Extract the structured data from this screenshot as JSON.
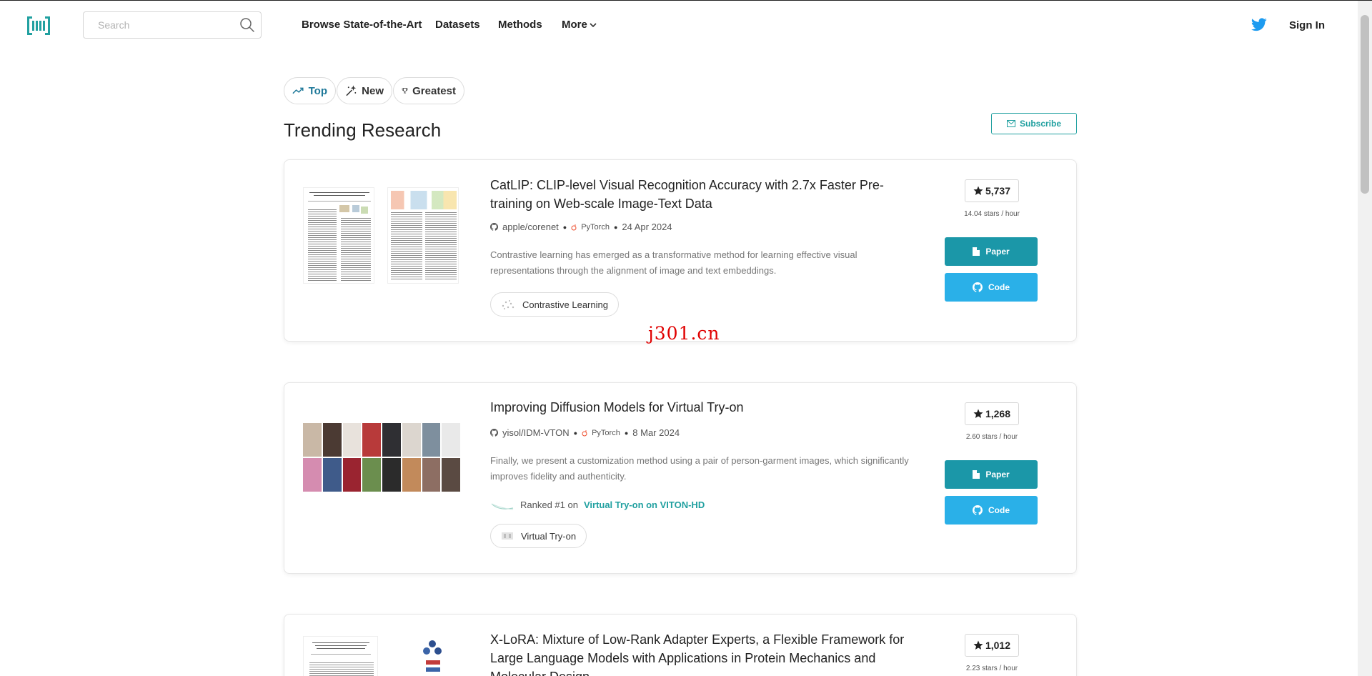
{
  "header": {
    "search_placeholder": "Search",
    "nav": {
      "browse": "Browse State-of-the-Art",
      "datasets": "Datasets",
      "methods": "Methods",
      "more": "More"
    },
    "signin": "Sign In"
  },
  "tabs": [
    {
      "label": "Top",
      "active": true
    },
    {
      "label": "New",
      "active": false
    },
    {
      "label": "Greatest",
      "active": false
    }
  ],
  "section_title": "Trending Research",
  "subscribe_label": "Subscribe",
  "colors": {
    "accent": "#21a0a0",
    "paper_button": "#1b97a8",
    "code_button": "#2ab0e8",
    "active_tab": "#1e7899"
  },
  "papers": [
    {
      "title": "CatLIP: CLIP-level Visual Recognition Accuracy with 2.7x Faster Pre-training on Web-scale Image-Text Data",
      "repo": "apple/corenet",
      "framework": "PyTorch",
      "date": "24 Apr 2024",
      "abstract": "Contrastive learning has emerged as a transformative method for learning effective visual representations through the alignment of image and text embeddings.",
      "tag": "Contrastive Learning",
      "stars": "5,737",
      "rate": "14.04 stars / hour",
      "paper_label": "Paper",
      "code_label": "Code"
    },
    {
      "title": "Improving Diffusion Models for Virtual Try-on",
      "repo": "yisol/IDM-VTON",
      "framework": "PyTorch",
      "date": "8 Mar 2024",
      "abstract": "Finally, we present a customization method using a pair of person-garment images, which significantly improves fidelity and authenticity.",
      "ranked_prefix": "Ranked #1 on",
      "ranked_link": "Virtual Try-on on VITON-HD",
      "tag": "Virtual Try-on",
      "stars": "1,268",
      "rate": "2.60 stars / hour",
      "paper_label": "Paper",
      "code_label": "Code"
    },
    {
      "title": "X-LoRA: Mixture of Low-Rank Adapter Experts, a Flexible Framework for Large Language Models with Applications in Protein Mechanics and Molecular Design",
      "stars": "1,012",
      "rate": "2.23 stars / hour"
    }
  ],
  "watermark": "j301.cn"
}
